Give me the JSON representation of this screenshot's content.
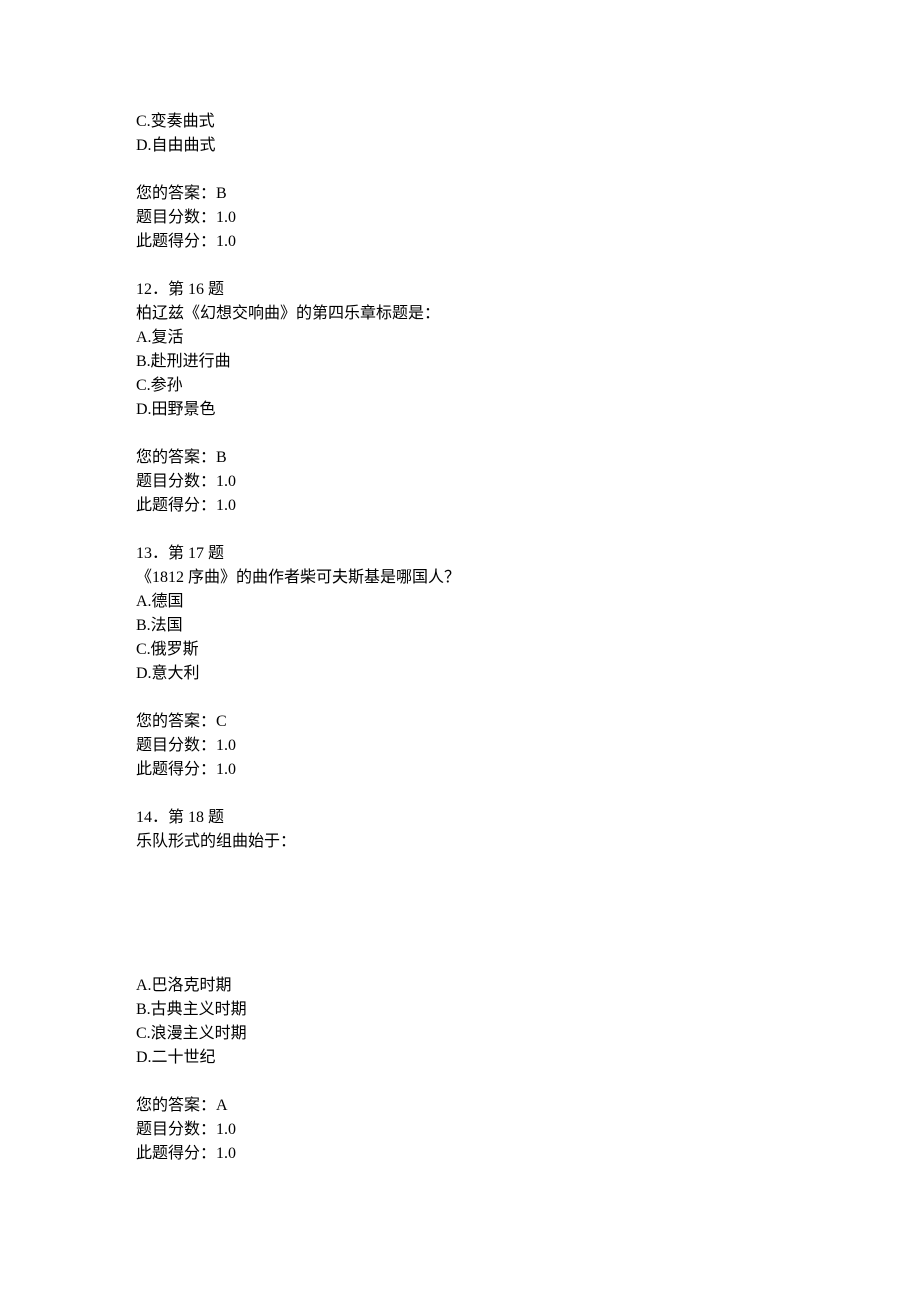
{
  "q11_partial": {
    "optC": "C.变奏曲式",
    "optD": "D.自由曲式",
    "answer": "您的答案：B",
    "score": "题目分数：1.0",
    "got": "此题得分：1.0"
  },
  "q12": {
    "header": "12．第 16 题",
    "stem": "柏辽兹《幻想交响曲》的第四乐章标题是：",
    "optA": "A.复活",
    "optB": "B.赴刑进行曲",
    "optC": "C.参孙",
    "optD": "D.田野景色",
    "answer": "您的答案：B",
    "score": "题目分数：1.0",
    "got": "此题得分：1.0"
  },
  "q13": {
    "header": "13．第 17 题",
    "stem": "《1812 序曲》的曲作者柴可夫斯基是哪国人？",
    "optA": "A.德国",
    "optB": "B.法国",
    "optC": "C.俄罗斯",
    "optD": "D.意大利",
    "answer": "您的答案：C",
    "score": "题目分数：1.0",
    "got": "此题得分：1.0"
  },
  "q14": {
    "header": "14．第 18 题",
    "stem": "乐队形式的组曲始于：",
    "optA": "A.巴洛克时期",
    "optB": "B.古典主义时期",
    "optC": "C.浪漫主义时期",
    "optD": "D.二十世纪",
    "answer": "您的答案：A",
    "score": "题目分数：1.0",
    "got": "此题得分：1.0"
  }
}
